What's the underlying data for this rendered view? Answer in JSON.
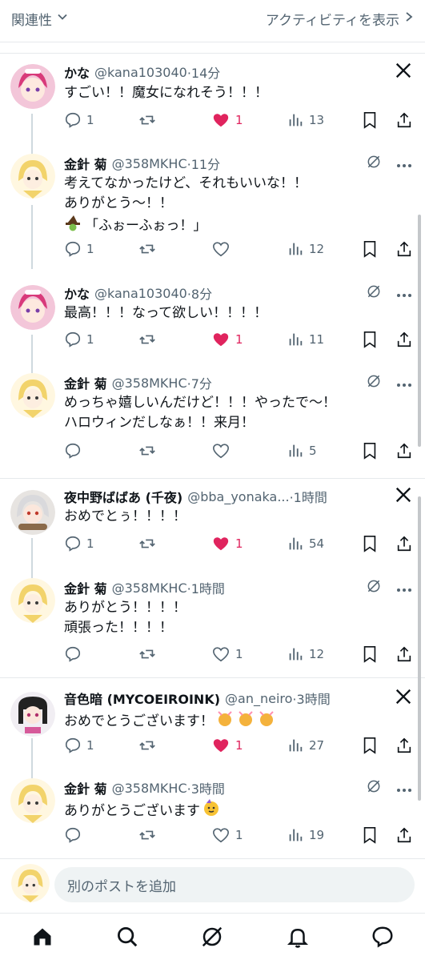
{
  "topbar": {
    "sort_label": "関連性",
    "activity_label": "アクティビティを表示"
  },
  "compose": {
    "placeholder": "別のポストを追加"
  },
  "posts": [
    {
      "name": "かな",
      "handle": "@kana103040",
      "time": "·14分",
      "lines": [
        "すごい！！魔女になれそう！！！"
      ],
      "replies": "1",
      "retweets": "",
      "likes": "1",
      "views": "13"
    },
    {
      "name": "金針 菊",
      "handle": "@358MKHC",
      "time": "·11分",
      "lines": [
        "考えてなかったけど、それもいいな！！",
        "ありがとう〜！！",
        "「ふぉーふぉっ！」"
      ],
      "replies": "1",
      "retweets": "",
      "likes": "",
      "views": "12"
    },
    {
      "name": "かな",
      "handle": "@kana103040",
      "time": "·8分",
      "lines": [
        "最高！！！なって欲しい！！！！"
      ],
      "replies": "1",
      "retweets": "",
      "likes": "1",
      "views": "11"
    },
    {
      "name": "金針 菊",
      "handle": "@358MKHC",
      "time": "·7分",
      "lines": [
        "めっちゃ嬉しいんだけど！！！やったで〜！",
        "ハロウィンだしなぁ！！来月！"
      ],
      "replies": "",
      "retweets": "",
      "likes": "",
      "views": "5"
    },
    {
      "name": "夜中野ばばあ (千夜)",
      "handle": "@bba_yonaka...",
      "time": "·1時間",
      "lines": [
        "おめでとぅ！！！！"
      ],
      "replies": "1",
      "retweets": "",
      "likes": "1",
      "views": "54"
    },
    {
      "name": "金針 菊",
      "handle": "@358MKHC",
      "time": "·1時間",
      "lines": [
        "ありがとう！！！！",
        "頑張った！！！！"
      ],
      "replies": "",
      "retweets": "",
      "likes": "1",
      "views": "12"
    },
    {
      "name": "音色暗 (MYCOEIROINK)",
      "handle": "@an_neiro",
      "time": "·3時間",
      "lines": [
        "おめでとうございます！"
      ],
      "replies": "1",
      "retweets": "",
      "likes": "1",
      "views": "27"
    },
    {
      "name": "金針 菊",
      "handle": "@358MKHC",
      "time": "·3時間",
      "lines": [
        "ありがとうございます"
      ],
      "replies": "",
      "retweets": "",
      "likes": "1",
      "views": "19"
    }
  ],
  "colors": {
    "like_active": "#e0245e",
    "muted": "#536471",
    "text": "#0f1419"
  },
  "icons": {
    "x_logo": "x-logo-icon",
    "grok": "grok-icon",
    "more": "more-icon"
  }
}
